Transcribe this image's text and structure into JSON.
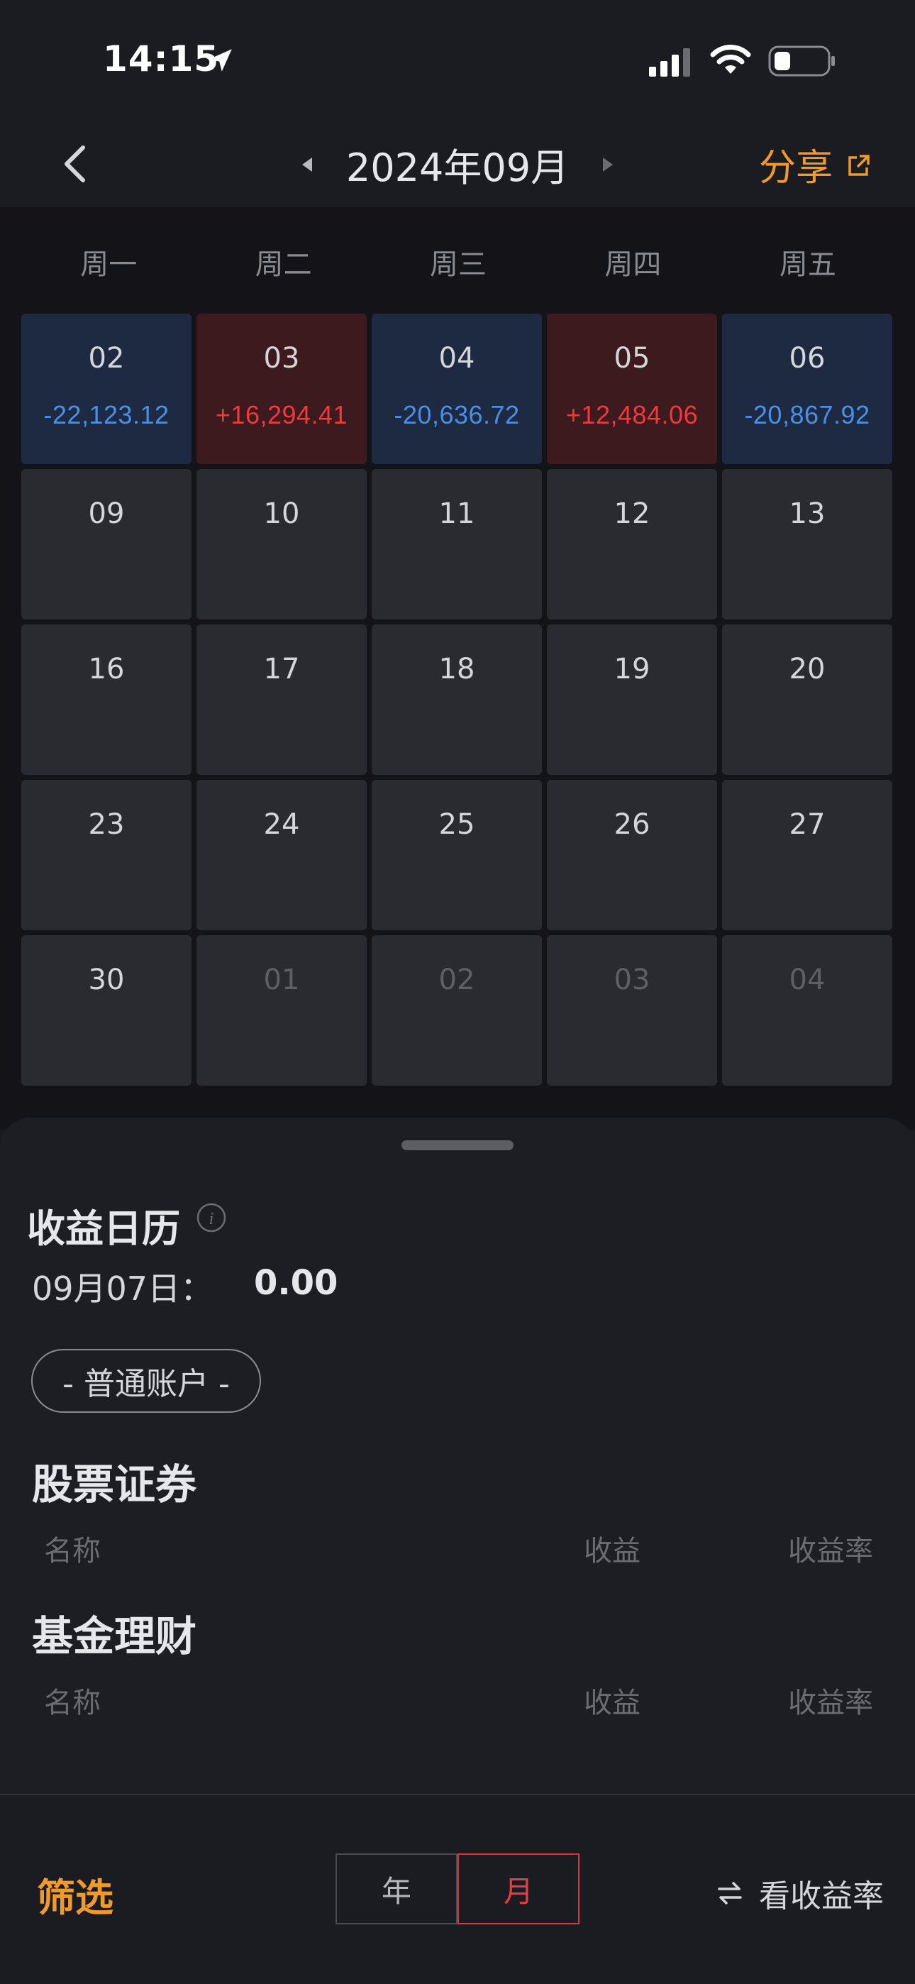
{
  "status": {
    "time": "14:15"
  },
  "nav": {
    "title": "2024年09月",
    "share_label": "分享"
  },
  "calendar": {
    "weekdays": [
      "周一",
      "周二",
      "周三",
      "周四",
      "周五"
    ],
    "rows": [
      [
        {
          "date": "02",
          "value": "-22,123.12",
          "kind": "loss"
        },
        {
          "date": "03",
          "value": "+16,294.41",
          "kind": "gain"
        },
        {
          "date": "04",
          "value": "-20,636.72",
          "kind": "loss"
        },
        {
          "date": "05",
          "value": "+12,484.06",
          "kind": "gain"
        },
        {
          "date": "06",
          "value": "-20,867.92",
          "kind": "loss"
        }
      ],
      [
        {
          "date": "09",
          "value": "",
          "kind": "none"
        },
        {
          "date": "10",
          "value": "",
          "kind": "none"
        },
        {
          "date": "11",
          "value": "",
          "kind": "none"
        },
        {
          "date": "12",
          "value": "",
          "kind": "none"
        },
        {
          "date": "13",
          "value": "",
          "kind": "none"
        }
      ],
      [
        {
          "date": "16",
          "value": "",
          "kind": "none"
        },
        {
          "date": "17",
          "value": "",
          "kind": "none"
        },
        {
          "date": "18",
          "value": "",
          "kind": "none"
        },
        {
          "date": "19",
          "value": "",
          "kind": "none"
        },
        {
          "date": "20",
          "value": "",
          "kind": "none"
        }
      ],
      [
        {
          "date": "23",
          "value": "",
          "kind": "none"
        },
        {
          "date": "24",
          "value": "",
          "kind": "none"
        },
        {
          "date": "25",
          "value": "",
          "kind": "none"
        },
        {
          "date": "26",
          "value": "",
          "kind": "none"
        },
        {
          "date": "27",
          "value": "",
          "kind": "none"
        }
      ],
      [
        {
          "date": "30",
          "value": "",
          "kind": "none"
        },
        {
          "date": "01",
          "value": "",
          "kind": "dim"
        },
        {
          "date": "02",
          "value": "",
          "kind": "dim"
        },
        {
          "date": "03",
          "value": "",
          "kind": "dim"
        },
        {
          "date": "04",
          "value": "",
          "kind": "dim"
        }
      ]
    ]
  },
  "sheet": {
    "title": "收益日历",
    "selected_date": "09月07日：",
    "selected_value": "0.00",
    "account": "- 普通账户 -",
    "stocks": {
      "title": "股票证券",
      "col_name": "名称",
      "col_profit": "收益",
      "col_rate": "收益率"
    },
    "funds": {
      "title": "基金理财",
      "col_name": "名称",
      "col_profit": "收益",
      "col_rate": "收益率"
    }
  },
  "toolbar": {
    "filter_label": "筛选",
    "year_label": "年",
    "month_label": "月",
    "view_rate_label": "看收益率"
  },
  "colors": {
    "accent": "#f09a2c",
    "gain": "#f0383d",
    "loss": "#4a8fe6"
  }
}
